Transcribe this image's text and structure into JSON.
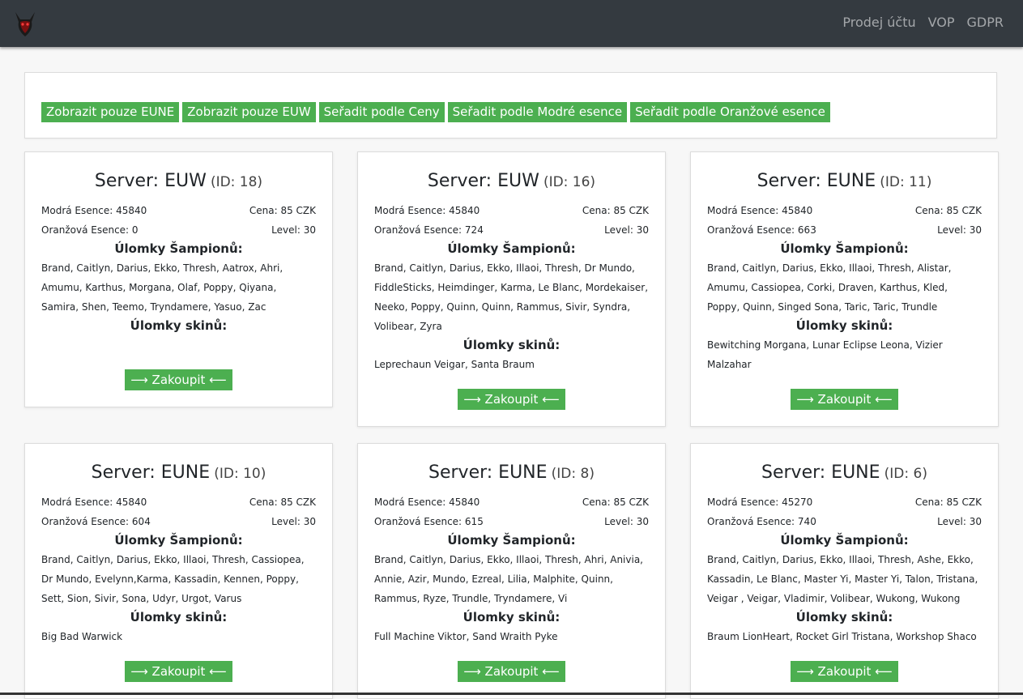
{
  "nav": {
    "logo_icon": "devil-mask-icon",
    "links": [
      "Prodej účtu",
      "VOP",
      "GDPR"
    ]
  },
  "filters": [
    "Zobrazit pouze EUNE",
    "Zobrazit pouze EUW",
    "Seřadit podle Ceny",
    "Seřadit podle Modré esence",
    "Seřadit podle Oranžové esence"
  ],
  "labels": {
    "blue": "Modrá Esence:",
    "price": "Cena:",
    "orange": "Oranžová Esence:",
    "level": "Level:",
    "champ_frag": "Úlomky Šampionů:",
    "skin_frag": "Úlomky skinů:",
    "buy": "⟶ Zakoupit ⟵"
  },
  "colors": {
    "accent": "#4caf50",
    "navbar": "#343a40"
  },
  "cards": [
    {
      "server": "Server: EUW",
      "id": "(ID: 18)",
      "blue": "45840",
      "price": "85 CZK",
      "orange": "0",
      "level": "30",
      "champions": "Brand, Caitlyn, Darius, Ekko, Thresh, Aatrox, Ahri, Amumu, Karthus, Morgana, Olaf, Poppy, Qiyana, Samira, Shen, Teemo, Tryndamere, Yasuo, Zac",
      "skins": ""
    },
    {
      "server": "Server: EUW",
      "id": "(ID: 16)",
      "blue": "45840",
      "price": "85 CZK",
      "orange": "724",
      "level": "30",
      "champions": "Brand, Caitlyn, Darius, Ekko, Illaoi, Thresh, Dr Mundo, FiddleSticks, Heimdinger, Karma, Le Blanc, Mordekaiser, Neeko, Poppy, Quinn, Quinn, Rammus, Sivir, Syndra, Volibear, Zyra",
      "skins": "Leprechaun Veigar, Santa Braum"
    },
    {
      "server": "Server: EUNE",
      "id": "(ID: 11)",
      "blue": "45840",
      "price": "85 CZK",
      "orange": "663",
      "level": "30",
      "champions": "Brand, Caitlyn, Darius, Ekko, Illaoi, Thresh, Alistar, Amumu, Cassiopea, Corki, Draven, Karthus, Kled, Poppy, Quinn, Singed Sona, Taric, Taric, Trundle",
      "skins": "Bewitching Morgana, Lunar Eclipse Leona, Vizier Malzahar"
    },
    {
      "server": "Server: EUNE",
      "id": "(ID: 10)",
      "blue": "45840",
      "price": "85 CZK",
      "orange": "604",
      "level": "30",
      "champions": "Brand, Caitlyn, Darius, Ekko, Illaoi, Thresh, Cassiopea, Dr Mundo, Evelynn,Karma, Kassadin, Kennen, Poppy, Sett, Sion, Sivir, Sona, Udyr, Urgot, Varus",
      "skins": "Big Bad Warwick"
    },
    {
      "server": "Server: EUNE",
      "id": "(ID: 8)",
      "blue": "45840",
      "price": "85 CZK",
      "orange": "615",
      "level": "30",
      "champions": "Brand, Caitlyn, Darius, Ekko, Illaoi, Thresh, Ahri, Anivia, Annie, Azir, Mundo, Ezreal, Lilia, Malphite, Quinn, Rammus, Ryze, Trundle, Tryndamere, Vi",
      "skins": "Full Machine Viktor, Sand Wraith Pyke"
    },
    {
      "server": "Server: EUNE",
      "id": "(ID: 6)",
      "blue": "45270",
      "price": "85 CZK",
      "orange": "740",
      "level": "30",
      "champions": "Brand, Caitlyn, Darius, Ekko, Illaoi, Thresh, Ashe, Ekko, Kassadin, Le Blanc, Master Yi, Master Yi, Talon, Tristana, Veigar , Veigar, Vladimir, Volibear, Wukong, Wukong",
      "skins": "Braum LionHeart, Rocket Girl Tristana, Workshop Shaco"
    }
  ]
}
